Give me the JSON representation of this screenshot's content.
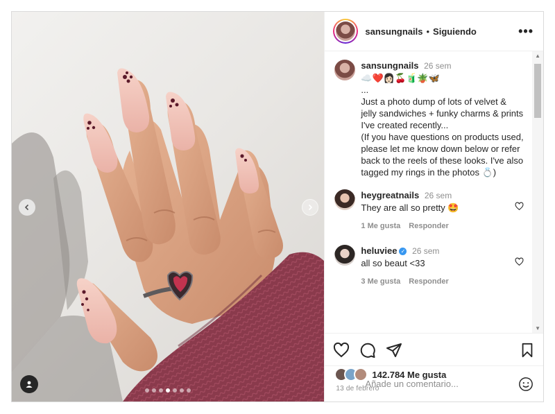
{
  "post": {
    "username": "sansungnails",
    "separator": "•",
    "follow_status": "Siguiendo",
    "more_label": "•••",
    "carousel": {
      "slide_count": 7,
      "active_index": 3
    }
  },
  "caption": {
    "username": "sansungnails",
    "time": "26 sem",
    "emojis": "☁️❤️👩🏻🍒🧃🪴🦋",
    "text": "...\nJust a photo dump of lots of velvet & jelly sandwiches + funky charms & prints I've created recently...\n(If you have questions on products used, please let me know down below or refer back to the reels of these looks. I've also tagged my rings in the photos 💍)"
  },
  "comments": [
    {
      "username": "heygreatnails",
      "time": "26 sem",
      "verified": false,
      "text": "They are all so pretty 🤩",
      "likes": "1 Me gusta",
      "reply": "Responder"
    },
    {
      "username": "heluviee",
      "time": "26 sem",
      "verified": true,
      "text": "all so beaut <33",
      "likes": "3 Me gusta",
      "reply": "Responder"
    }
  ],
  "stats": {
    "likes": "142.784 Me gusta",
    "date": "13 de febrero"
  },
  "composer": {
    "placeholder": "Añade un comentario..."
  },
  "colors": {
    "accent": "#3897f0",
    "sweater": "#8d3b4d",
    "nail": "#f2c1b8"
  }
}
